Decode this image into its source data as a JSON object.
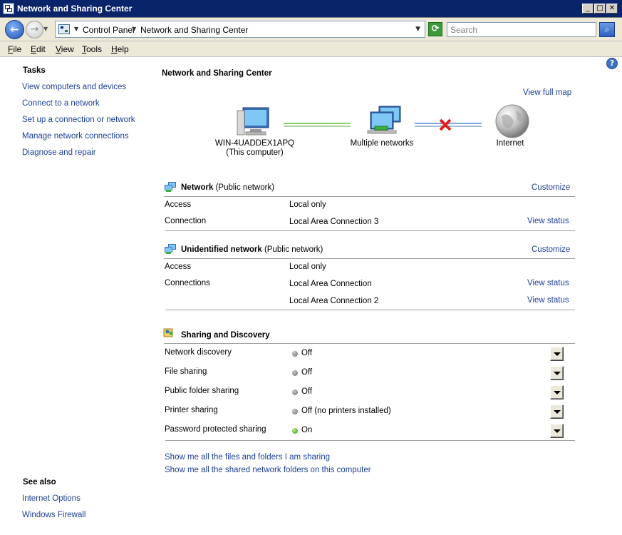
{
  "window": {
    "title": "Network and Sharing Center"
  },
  "address": {
    "crumbs": [
      "Control Panel",
      "Network and Sharing Center"
    ],
    "search_placeholder": "Search"
  },
  "menu": [
    "File",
    "Edit",
    "View",
    "Tools",
    "Help"
  ],
  "menu_accel": [
    "F",
    "E",
    "V",
    "T",
    "H"
  ],
  "left": {
    "tasks_heading": "Tasks",
    "tasks": [
      "View computers and devices",
      "Connect to a network",
      "Set up a connection or network",
      "Manage network connections",
      "Diagnose and repair"
    ],
    "see_also_heading": "See also",
    "see_also": [
      "Internet Options",
      "Windows Firewall"
    ]
  },
  "main": {
    "title": "Network and Sharing Center",
    "view_full_map": "View full map",
    "map": {
      "computer_name": "WIN-4UADDEX1APQ",
      "computer_sub": "(This computer)",
      "networks_label": "Multiple networks",
      "internet_label": "Internet"
    },
    "network1": {
      "name": "Network",
      "type": "(Public network)",
      "customize": "Customize",
      "access_label": "Access",
      "access_value": "Local only",
      "connection_label": "Connection",
      "connection_value": "Local Area Connection 3",
      "view_status": "View status"
    },
    "network2": {
      "name": "Unidentified network",
      "type": "(Public network)",
      "customize": "Customize",
      "access_label": "Access",
      "access_value": "Local only",
      "connections_label": "Connections",
      "connection_values": [
        "Local Area Connection",
        "Local Area Connection 2"
      ],
      "view_status": "View status"
    },
    "sharing": {
      "heading": "Sharing and Discovery",
      "rows": [
        {
          "label": "Network discovery",
          "value": "Off",
          "state": "off"
        },
        {
          "label": "File sharing",
          "value": "Off",
          "state": "off"
        },
        {
          "label": "Public folder sharing",
          "value": "Off",
          "state": "off"
        },
        {
          "label": "Printer sharing",
          "value": "Off (no printers installed)",
          "state": "off"
        },
        {
          "label": "Password protected sharing",
          "value": "On",
          "state": "on"
        }
      ],
      "links": [
        "Show me all the files and folders I am sharing",
        "Show me all the shared network folders on this computer"
      ]
    }
  },
  "colors": {
    "link": "#1e3f98",
    "titlebar": "#0a246a",
    "status_on": "#2e9a1a",
    "status_off": "#6e6e6e",
    "disconnect": "#e02020"
  }
}
